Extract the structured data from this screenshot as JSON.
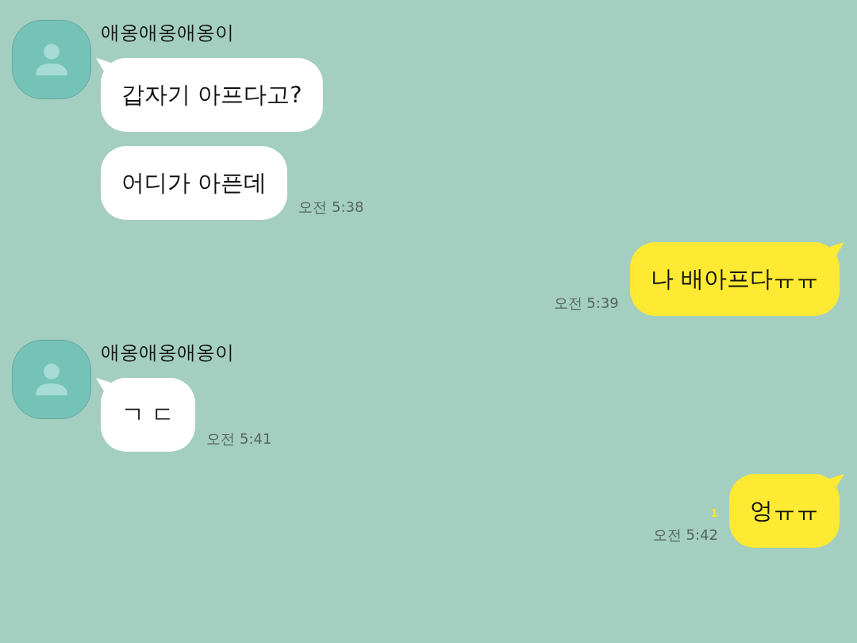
{
  "groups": [
    {
      "kind": "received",
      "sender": "애옹애옹애옹이",
      "messages": [
        "갑자기 아프다고?",
        "어디가 아픈데"
      ],
      "time": "오전 5:38"
    },
    {
      "kind": "sent",
      "messages": [
        "나 배아프다ㅠㅠ"
      ],
      "time": "오전 5:39"
    },
    {
      "kind": "received",
      "sender": "애옹애옹애옹이",
      "messages": [
        "ㄱ ㄷ"
      ],
      "time": "오전 5:41"
    },
    {
      "kind": "sent",
      "messages": [
        "엉ㅠㅠ"
      ],
      "time": "오전 5:42",
      "unread": "1"
    }
  ]
}
